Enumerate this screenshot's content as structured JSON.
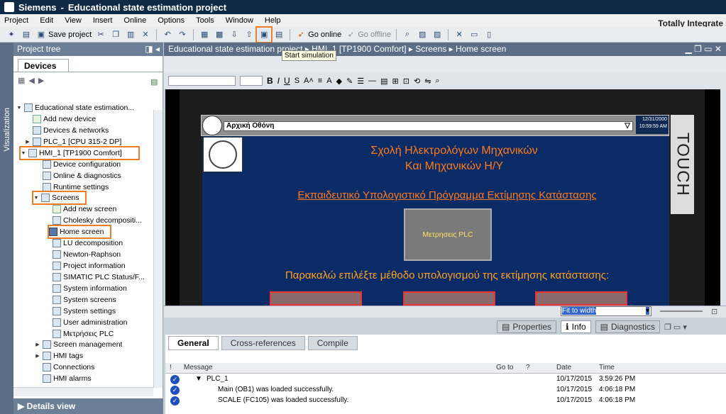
{
  "window": {
    "app": "Siemens",
    "project": "Educational state estimation project",
    "brand": "Totally Integrate"
  },
  "menu": [
    "Project",
    "Edit",
    "View",
    "Insert",
    "Online",
    "Options",
    "Tools",
    "Window",
    "Help"
  ],
  "toolbar": {
    "save_project": "Save project",
    "go_online": "Go online",
    "go_offline": "Go offline",
    "tooltip": "Start simulation"
  },
  "sidebar": {
    "vertical_tab": "Visualization"
  },
  "project_tree": {
    "title": "Project tree",
    "devices_tab": "Devices",
    "items": [
      {
        "label": "Educational state estimation..."
      },
      {
        "label": "Add new device"
      },
      {
        "label": "Devices & networks"
      },
      {
        "label": "PLC_1 [CPU 315-2 DP]"
      },
      {
        "label": "HMI_1 [TP1900 Comfort]"
      },
      {
        "label": "Device configuration"
      },
      {
        "label": "Online & diagnostics"
      },
      {
        "label": "Runtime settings"
      },
      {
        "label": "Screens"
      },
      {
        "label": "Add new screen"
      },
      {
        "label": "Cholesky decompositi..."
      },
      {
        "label": "Home screen"
      },
      {
        "label": "LU decomposition"
      },
      {
        "label": "Newton-Raphson"
      },
      {
        "label": "Project information"
      },
      {
        "label": "SIMATIC PLC Status/F..."
      },
      {
        "label": "System information"
      },
      {
        "label": "System screens"
      },
      {
        "label": "System settings"
      },
      {
        "label": "User administration"
      },
      {
        "label": "Μετρήσεις PLC"
      },
      {
        "label": "Screen management"
      },
      {
        "label": "HMI tags"
      },
      {
        "label": "Connections"
      },
      {
        "label": "HMI alarms"
      }
    ],
    "details_view": "Details view"
  },
  "editor": {
    "breadcrumb": "HMI_1 [TP1900 Comfort]  ▸  Screens  ▸  Home screen",
    "breadcrumb_prefix": "Educational state estimation project",
    "hmi": {
      "screen_name": "Αρχική Οθόνη",
      "date": "12/31/2000",
      "time": "10:59:59 AM",
      "touch_label": "TOUCH",
      "heading_line1": "Σχολή Ηλεκτρολόγων Μηχανικών",
      "heading_line2": "Και Μηχανικών Η/Υ",
      "subtitle": "Εκπαιδευτικό Υπολογιστικό Πρόγραμμα Εκτίμησης Κατάστασης",
      "plc_button": "Μετρησεις PLC",
      "prompt": "Παρακαλώ επιλέξτε μέθοδο υπολογισμού της εκτίμησης κατάστασης:"
    },
    "zoom": "Fit to width"
  },
  "inspector": {
    "tabs": {
      "properties": "Properties",
      "info": "Info",
      "diagnostics": "Diagnostics"
    },
    "subtabs": {
      "general": "General",
      "cross_references": "Cross-references",
      "compile": "Compile"
    },
    "columns": {
      "message": "Message",
      "goto": "Go to",
      "question": "?",
      "date": "Date",
      "time": "Time"
    },
    "messages": [
      {
        "text": "PLC_1",
        "date": "10/17/2015",
        "time": "3:59:26 PM"
      },
      {
        "text": "Main (OB1) was loaded successfully.",
        "date": "10/17/2015",
        "time": "4:06:18 PM"
      },
      {
        "text": "SCALE (FC105) was loaded successfully.",
        "date": "10/17/2015",
        "time": "4:06:18 PM"
      }
    ]
  },
  "colors": {
    "accent_highlight": "#f07e26",
    "hmi_background": "#0b2b66",
    "hmi_title": "#ff7a1c",
    "title_bar": "#0f2a45"
  }
}
